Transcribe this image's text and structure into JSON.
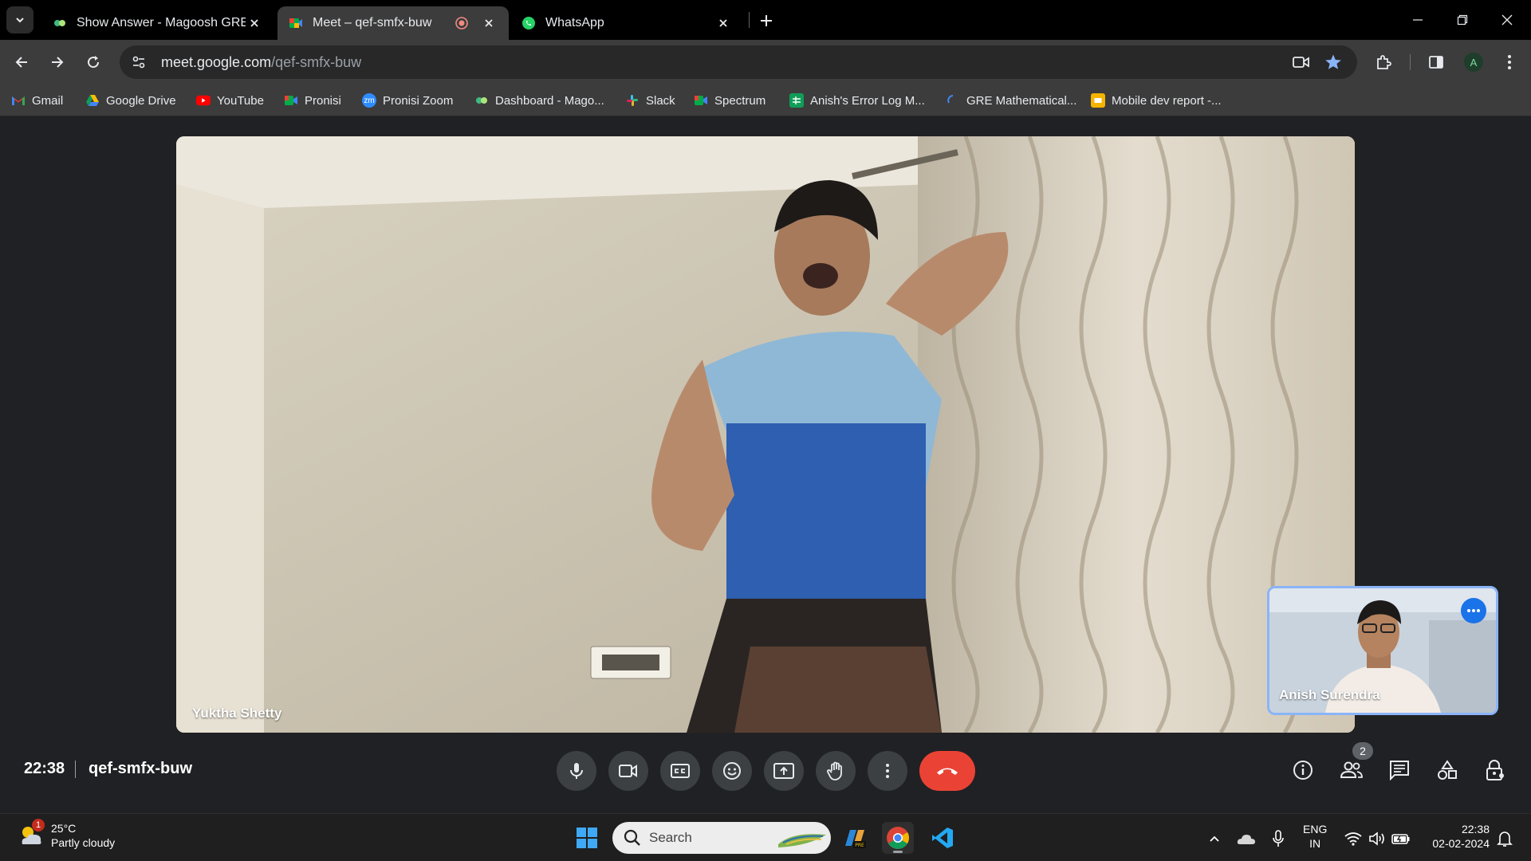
{
  "tabs": [
    {
      "title": "Show Answer - Magoosh GRE",
      "active": false
    },
    {
      "title": "Meet – qef-smfx-buw",
      "active": true,
      "recording": true
    },
    {
      "title": "WhatsApp",
      "active": false
    }
  ],
  "address_bar": {
    "domain": "meet.google.com",
    "path": "/qef-smfx-buw"
  },
  "profile_initial": "A",
  "bookmarks": [
    {
      "label": "Gmail",
      "icon": "gmail-icon"
    },
    {
      "label": "Google Drive",
      "icon": "drive-icon"
    },
    {
      "label": "YouTube",
      "icon": "youtube-icon"
    },
    {
      "label": "Pronisi",
      "icon": "meet-icon"
    },
    {
      "label": "Pronisi Zoom",
      "icon": "zoom-icon",
      "icon_text": "zm"
    },
    {
      "label": "Dashboard - Mago...",
      "icon": "magoosh-icon"
    },
    {
      "label": "Slack",
      "icon": "slack-icon"
    },
    {
      "label": "Spectrum",
      "icon": "meet-icon"
    },
    {
      "label": "Anish's Error Log M...",
      "icon": "sheets-icon"
    },
    {
      "label": "GRE Mathematical...",
      "icon": "loading-icon"
    },
    {
      "label": "Mobile dev report -...",
      "icon": "slides-icon"
    }
  ],
  "meet": {
    "main_participant": "Yuktha Shetty",
    "self_participant": "Anish Surendra",
    "time": "22:38",
    "meeting_code": "qef-smfx-buw",
    "participant_count": "2"
  },
  "taskbar": {
    "weather_temp": "25°C",
    "weather_desc": "Partly cloudy",
    "weather_badge": "1",
    "search_label": "Search",
    "lang_top": "ENG",
    "lang_bottom": "IN",
    "time": "22:38",
    "date": "02-02-2024"
  },
  "colors": {
    "accent": "#8ab4f8",
    "end_call": "#ea4335",
    "self_border": "#8ab4f8"
  }
}
